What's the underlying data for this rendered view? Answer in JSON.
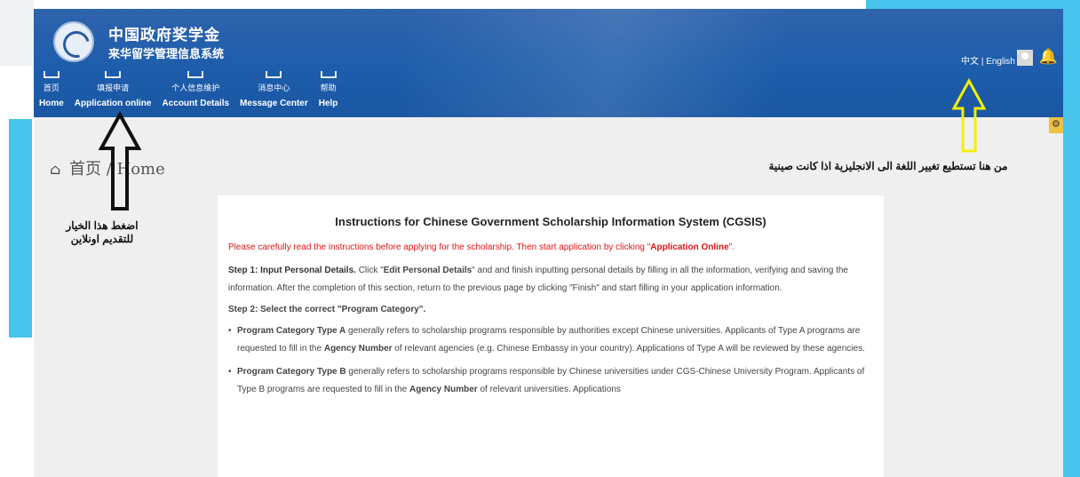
{
  "header": {
    "title_cn": "中国政府奖学金",
    "subtitle_cn": "来华留学管理信息系统",
    "language_switch": "中文 | English"
  },
  "nav": [
    {
      "cn": "首页",
      "en": "Home"
    },
    {
      "cn": "填报申请",
      "en": "Application online"
    },
    {
      "cn": "个人信息维护",
      "en": "Account Details"
    },
    {
      "cn": "消息中心",
      "en": "Message Center"
    },
    {
      "cn": "帮助",
      "en": "Help"
    }
  ],
  "breadcrumb": {
    "cn": "首页",
    "separator": "/",
    "en": "Home"
  },
  "instructions": {
    "title": "Instructions for Chinese Government Scholarship Information System (CGSIS)",
    "notice_prefix": "Please carefully read the instructions before applying for the scholarship. Then start application by clicking \"",
    "notice_bold": "Application Online",
    "notice_suffix": "\".",
    "step1_title": "Step 1: Input Personal Details.",
    "step1_pre": " Click \"",
    "step1_bold": "Edit Personal Details",
    "step1_body": "\" and and finish inputting personal details by filling in all the information, verifying and saving the information. After the completion of this section, return to the previous page by clicking \"Finish\" and start filling in your application information.",
    "step2_title": "Step 2: Select the correct \"Program Category\".",
    "typeA_bold": "Program Category Type A",
    "typeA_body1": " generally refers to scholarship programs responsible by authorities except Chinese universities. Applicants of Type A programs are requested to fill in the ",
    "typeA_agency": "Agency Number",
    "typeA_body2": " of relevant agencies (e.g. Chinese Embassy in your country). Applications of Type A will be reviewed by these agencies.",
    "typeB_bold": "Program Category Type B",
    "typeB_body1": " generally refers to scholarship programs responsible by Chinese universities under CGS-Chinese University Program. Applicants of Type B programs are requested to fill in the ",
    "typeB_agency": "Agency Number",
    "typeB_body2": " of relevant universities. Applications"
  },
  "annotations": {
    "apply_hint": "اضغط هذا الخيار للتقديم اونلاين",
    "language_hint": "من هنا تستطيع تغيير اللغة الى الانجليزية اذا كانت صينية"
  },
  "colors": {
    "header_blue": "#1d5dab",
    "frame_cyan": "#48c3ec",
    "arrow_yellow": "#f5f000",
    "notice_red": "#e01515"
  }
}
